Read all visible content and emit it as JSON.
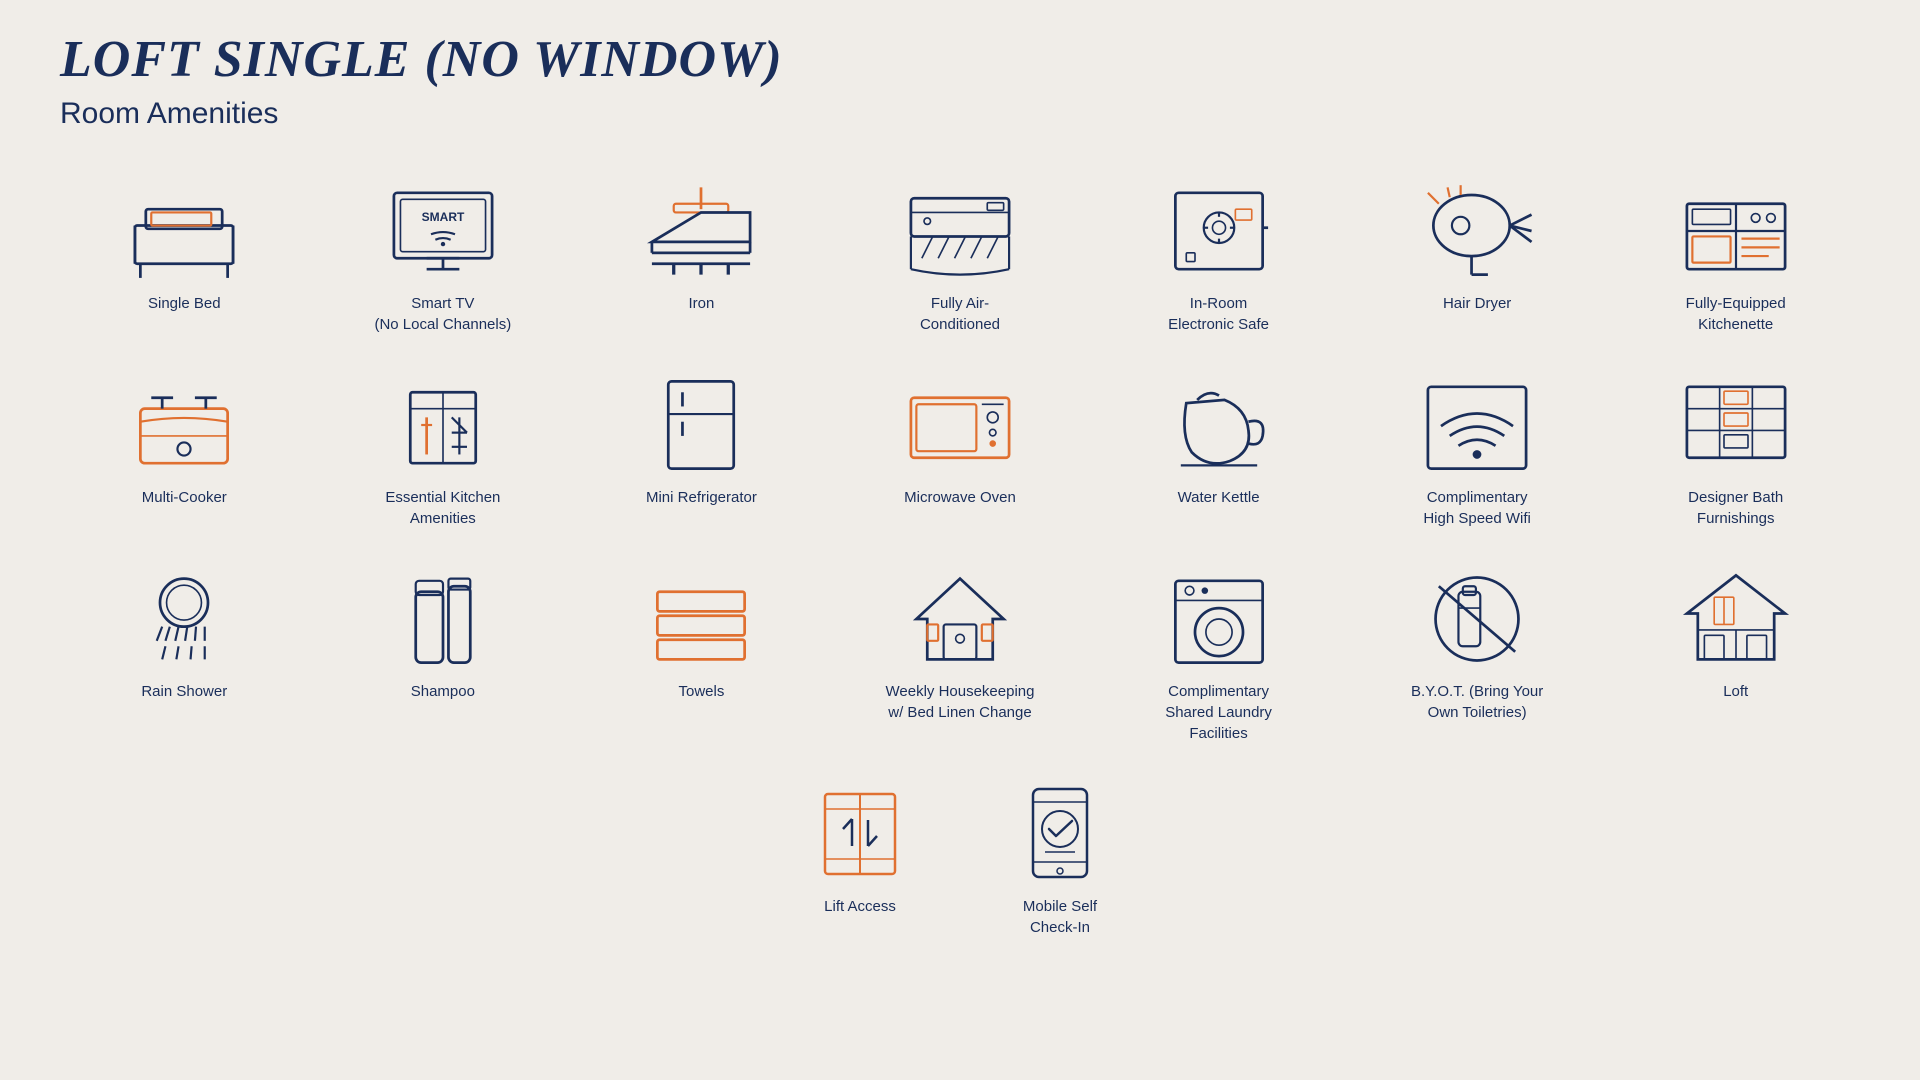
{
  "page": {
    "title": "LOFT SINGLE (NO WINDOW)",
    "subtitle": "Room Amenities"
  },
  "amenities": [
    {
      "id": "single-bed",
      "label": "Single Bed"
    },
    {
      "id": "smart-tv",
      "label": "Smart TV\n(No Local Channels)"
    },
    {
      "id": "iron",
      "label": "Iron"
    },
    {
      "id": "air-conditioned",
      "label": "Fully Air-\nConditioned"
    },
    {
      "id": "electronic-safe",
      "label": "In-Room\nElectronic Safe"
    },
    {
      "id": "hair-dryer",
      "label": "Hair Dryer"
    },
    {
      "id": "kitchenette",
      "label": "Fully-Equipped\nKitchenette"
    },
    {
      "id": "multi-cooker",
      "label": "Multi-Cooker"
    },
    {
      "id": "kitchen-amenities",
      "label": "Essential Kitchen\nAmenities"
    },
    {
      "id": "mini-refrigerator",
      "label": "Mini Refrigerator"
    },
    {
      "id": "microwave-oven",
      "label": "Microwave Oven"
    },
    {
      "id": "water-kettle",
      "label": "Water Kettle"
    },
    {
      "id": "wifi",
      "label": "Complimentary\nHigh Speed Wifi"
    },
    {
      "id": "designer-bath",
      "label": "Designer Bath\nFurnishings"
    },
    {
      "id": "rain-shower",
      "label": "Rain Shower"
    },
    {
      "id": "shampoo",
      "label": "Shampoo"
    },
    {
      "id": "towels",
      "label": "Towels"
    },
    {
      "id": "housekeeping",
      "label": "Weekly Housekeeping\nw/ Bed Linen Change"
    },
    {
      "id": "laundry",
      "label": "Complimentary\nShared Laundry\nFacilities"
    },
    {
      "id": "byot",
      "label": "B.Y.O.T. (Bring Your\nOwn Toiletries)"
    },
    {
      "id": "loft",
      "label": "Loft"
    }
  ],
  "bottom_amenities": [
    {
      "id": "lift-access",
      "label": "Lift Access"
    },
    {
      "id": "mobile-checkin",
      "label": "Mobile Self\nCheck-In"
    }
  ]
}
